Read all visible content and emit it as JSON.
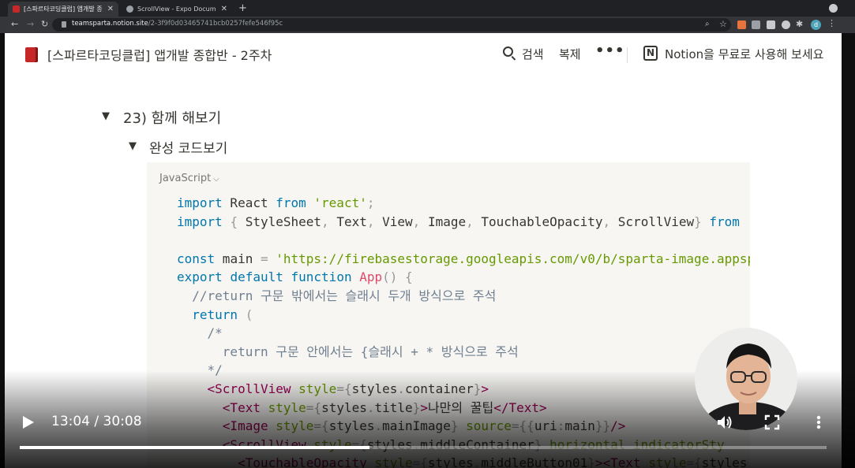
{
  "browser": {
    "tabs": [
      {
        "title": "[스파르타코딩클럽] 앱개발 종합반 - 2주차",
        "active": true,
        "favicon_color": "#c62828"
      },
      {
        "title": "ScrollView - Expo Documentation",
        "active": false,
        "favicon_color": "#9aa0a6"
      }
    ],
    "new_tab": "+",
    "url_host": "teamsparta.notion.site",
    "url_path": "/2-3f9f0d03465741bcb0257fefe546f95c",
    "profile_initial": "d"
  },
  "notion": {
    "page_title": "[스파르타코딩클럽] 앱개발 종합반 - 2주차",
    "search_label": "검색",
    "duplicate_label": "복제",
    "more_label": "•••",
    "cta_label": "Notion을 무료로 사용해 보세요",
    "notion_logo": "N",
    "toggle_heading_1": "23) 함께 해보기",
    "toggle_heading_2": "완성 코드보기",
    "code_language": "JavaScript",
    "code_lines": [
      [
        {
          "t": "import",
          "c": "kw"
        },
        {
          "t": " React "
        },
        {
          "t": "from",
          "c": "kw"
        },
        {
          "t": " "
        },
        {
          "t": "'react'",
          "c": "str"
        },
        {
          "t": ";",
          "c": "pn"
        }
      ],
      [
        {
          "t": "import",
          "c": "kw"
        },
        {
          "t": " "
        },
        {
          "t": "{",
          "c": "pn"
        },
        {
          "t": " StyleSheet"
        },
        {
          "t": ",",
          "c": "pn"
        },
        {
          "t": " Text"
        },
        {
          "t": ",",
          "c": "pn"
        },
        {
          "t": " View"
        },
        {
          "t": ",",
          "c": "pn"
        },
        {
          "t": " Image"
        },
        {
          "t": ",",
          "c": "pn"
        },
        {
          "t": " TouchableOpacity"
        },
        {
          "t": ",",
          "c": "pn"
        },
        {
          "t": " ScrollView"
        },
        {
          "t": "}",
          "c": "pn"
        },
        {
          "t": " "
        },
        {
          "t": "from",
          "c": "kw"
        }
      ],
      [],
      [
        {
          "t": "const",
          "c": "kw"
        },
        {
          "t": " main "
        },
        {
          "t": "=",
          "c": "pn"
        },
        {
          "t": " "
        },
        {
          "t": "'https://firebasestorage.googleapis.com/v0/b/sparta-image.appsp",
          "c": "str"
        }
      ],
      [
        {
          "t": "export",
          "c": "kw"
        },
        {
          "t": " "
        },
        {
          "t": "default",
          "c": "kw"
        },
        {
          "t": " "
        },
        {
          "t": "function",
          "c": "kw"
        },
        {
          "t": " "
        },
        {
          "t": "App",
          "c": "fn"
        },
        {
          "t": "()",
          "c": "pn"
        },
        {
          "t": " "
        },
        {
          "t": "{",
          "c": "pn"
        }
      ],
      [
        {
          "t": "  //return 구문 밖에서는 슬래시 두개 방식으로 주석",
          "c": "cm"
        }
      ],
      [
        {
          "t": "  "
        },
        {
          "t": "return",
          "c": "kw"
        },
        {
          "t": " "
        },
        {
          "t": "(",
          "c": "pn"
        }
      ],
      [
        {
          "t": "    /*",
          "c": "cm"
        }
      ],
      [
        {
          "t": "      return 구문 안에서는 {슬래시 + * 방식으로 주석",
          "c": "cm"
        }
      ],
      [
        {
          "t": "    */",
          "c": "cm"
        }
      ],
      [
        {
          "t": "    "
        },
        {
          "t": "<ScrollView",
          "c": "tg"
        },
        {
          "t": " "
        },
        {
          "t": "style",
          "c": "at"
        },
        {
          "t": "=",
          "c": "pn"
        },
        {
          "t": "{",
          "c": "pn"
        },
        {
          "t": "styles"
        },
        {
          "t": ".",
          "c": "pn"
        },
        {
          "t": "container"
        },
        {
          "t": "}",
          "c": "pn"
        },
        {
          "t": ">",
          "c": "tg"
        }
      ],
      [
        {
          "t": "      "
        },
        {
          "t": "<Text",
          "c": "tg"
        },
        {
          "t": " "
        },
        {
          "t": "style",
          "c": "at"
        },
        {
          "t": "=",
          "c": "pn"
        },
        {
          "t": "{",
          "c": "pn"
        },
        {
          "t": "styles"
        },
        {
          "t": ".",
          "c": "pn"
        },
        {
          "t": "title"
        },
        {
          "t": "}",
          "c": "pn"
        },
        {
          "t": ">",
          "c": "tg"
        },
        {
          "t": "나만의 꿀팁"
        },
        {
          "t": "</Text>",
          "c": "tg"
        }
      ],
      [
        {
          "t": "      "
        },
        {
          "t": "<Image",
          "c": "tg"
        },
        {
          "t": " "
        },
        {
          "t": "style",
          "c": "at"
        },
        {
          "t": "=",
          "c": "pn"
        },
        {
          "t": "{",
          "c": "pn"
        },
        {
          "t": "styles"
        },
        {
          "t": ".",
          "c": "pn"
        },
        {
          "t": "mainImage"
        },
        {
          "t": "}",
          "c": "pn"
        },
        {
          "t": " "
        },
        {
          "t": "source",
          "c": "at"
        },
        {
          "t": "=",
          "c": "pn"
        },
        {
          "t": "{{",
          "c": "pn"
        },
        {
          "t": "uri"
        },
        {
          "t": ":",
          "c": "pn"
        },
        {
          "t": "main"
        },
        {
          "t": "}}",
          "c": "pn"
        },
        {
          "t": "/>",
          "c": "tg"
        }
      ],
      [
        {
          "t": "      "
        },
        {
          "t": "<ScrollView",
          "c": "tg"
        },
        {
          "t": " "
        },
        {
          "t": "style",
          "c": "at"
        },
        {
          "t": "=",
          "c": "pn"
        },
        {
          "t": "{",
          "c": "pn"
        },
        {
          "t": "styles"
        },
        {
          "t": ".",
          "c": "pn"
        },
        {
          "t": "middleContainer"
        },
        {
          "t": "}",
          "c": "pn"
        },
        {
          "t": " "
        },
        {
          "t": "horizontal",
          "c": "at"
        },
        {
          "t": " "
        },
        {
          "t": "indicatorSty",
          "c": "at"
        }
      ],
      [
        {
          "t": "        "
        },
        {
          "t": "<TouchableOpacity",
          "c": "tg"
        },
        {
          "t": " "
        },
        {
          "t": "style",
          "c": "at"
        },
        {
          "t": "=",
          "c": "pn"
        },
        {
          "t": "{",
          "c": "pn"
        },
        {
          "t": "styles"
        },
        {
          "t": ".",
          "c": "pn"
        },
        {
          "t": "middleButton01"
        },
        {
          "t": "}",
          "c": "pn"
        },
        {
          "t": ">",
          "c": "tg"
        },
        {
          "t": "<Text",
          "c": "tg"
        },
        {
          "t": " "
        },
        {
          "t": "style",
          "c": "at"
        },
        {
          "t": "=",
          "c": "pn"
        },
        {
          "t": "{",
          "c": "pn"
        },
        {
          "t": "styles"
        }
      ]
    ]
  },
  "video": {
    "current_time": "13:04",
    "duration": "30:08",
    "time_display": "13:04 / 30:08",
    "progress_fraction": 0.4336,
    "icons": [
      "play-icon",
      "volume-icon",
      "fullscreen-icon",
      "more-vert-icon"
    ]
  }
}
